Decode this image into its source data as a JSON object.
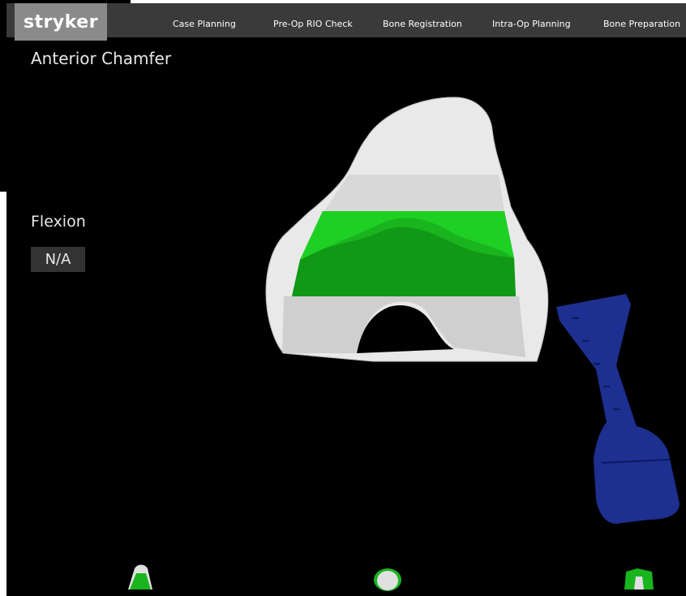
{
  "brand": {
    "logo": "stryker"
  },
  "nav": {
    "items": [
      {
        "label": "Case Planning"
      },
      {
        "label": "Pre-Op RIO Check"
      },
      {
        "label": "Bone Registration"
      },
      {
        "label": "Intra-Op Planning"
      },
      {
        "label": "Bone Preparation"
      }
    ]
  },
  "main": {
    "title": "Anterior Chamfer",
    "flexion": {
      "label": "Flexion",
      "value": "N/A"
    }
  },
  "viewport": {
    "model": "femur-bone-icon",
    "cut_region_color": "#19b41e",
    "bone_color": "#e9e9e9",
    "tool_color": "#1d2f8f",
    "tool": "cutting-tool-icon"
  },
  "thumbnails": [
    {
      "icon": "femur-front-view-icon"
    },
    {
      "icon": "femur-axial-view-icon"
    },
    {
      "icon": "femur-side-view-icon"
    }
  ]
}
